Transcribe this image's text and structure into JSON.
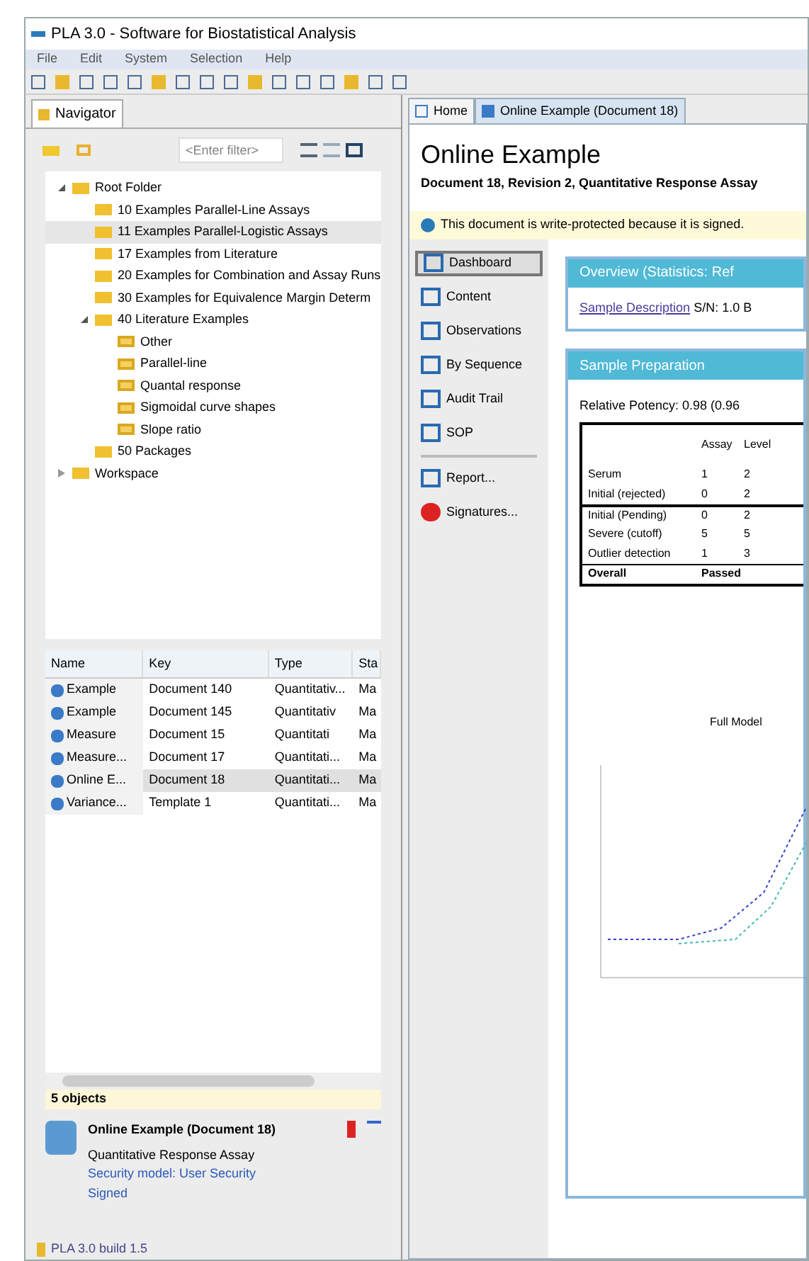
{
  "window": {
    "title": "PLA 3.0 - Software for Biostatistical Analysis"
  },
  "menu": [
    "File",
    "Edit",
    "System",
    "Selection",
    "Help"
  ],
  "navigator": {
    "tab": "Navigator",
    "filter": {
      "placeholder": "<Enter filter>"
    },
    "tree": [
      {
        "label": "Root Folder",
        "expanded": true,
        "selected": false,
        "children": [
          {
            "label": "10 Examples Parallel-Line Assays",
            "selected": false
          },
          {
            "label": "11 Examples Parallel-Logistic Assays",
            "selected": true
          },
          {
            "label": "17 Examples from Literature",
            "selected": false
          },
          {
            "label": "20 Examples for Combination and Assay Runs",
            "selected": false
          },
          {
            "label": "30 Examples for Equivalence Margin Determ",
            "selected": false
          },
          {
            "label": "40 Literature Examples",
            "expanded": true,
            "selected": false,
            "children": [
              {
                "label": "Other",
                "selected": false
              },
              {
                "label": "Parallel-line",
                "selected": false
              },
              {
                "label": "Quantal response",
                "selected": false
              },
              {
                "label": "Sigmoidal curve shapes",
                "selected": false
              },
              {
                "label": "Slope ratio",
                "selected": false
              }
            ]
          },
          {
            "label": "50 Packages",
            "selected": false
          }
        ]
      },
      {
        "label": "Workspace",
        "expanded": false,
        "selected": false
      }
    ]
  },
  "table": {
    "columns": [
      "Name",
      "Key",
      "Type",
      "Sta"
    ],
    "rows": [
      {
        "cells": [
          "Example",
          "Document 140",
          "Quantitativ...",
          "Ma"
        ],
        "selected": false
      },
      {
        "cells": [
          "Example",
          "Document 145",
          "Quantitativ",
          "Ma"
        ],
        "selected": false
      },
      {
        "cells": [
          "Measure",
          "Document 15",
          "Quantitati",
          "Ma"
        ],
        "selected": false
      },
      {
        "cells": [
          "Measure...",
          "Document 17",
          "Quantitati...",
          "Ma"
        ],
        "selected": false
      },
      {
        "cells": [
          "Online E...",
          "Document 18",
          "Quantitati...",
          "Ma"
        ],
        "selected": true
      },
      {
        "cells": [
          "Variance...",
          "Template 1",
          "Quantitati...",
          "Ma"
        ],
        "selected": false
      }
    ]
  },
  "objects_count": "5 objects",
  "detail": {
    "title": "Online Example (Document 18)",
    "lines": [
      "Quantitative Response Assay",
      "Security model: User Security",
      "Signed"
    ]
  },
  "status_bar": "PLA 3.0 build 1.5",
  "editor": {
    "tabs": [
      {
        "label": "Home",
        "selected": false
      },
      {
        "label": "Online Example (Document 18)",
        "selected": true
      }
    ],
    "title": "Online Example",
    "subtitle": "Document 18, Revision 2, Quantitative Response Assay",
    "info": "This document is write-protected because it is signed.",
    "nav": [
      {
        "label": "Dashboard",
        "selected": true
      },
      {
        "label": "Content",
        "selected": false
      },
      {
        "label": "Observations",
        "selected": false
      },
      {
        "label": "By Sequence",
        "selected": false
      },
      {
        "label": "Audit Trail",
        "selected": false
      },
      {
        "label": "SOP",
        "selected": false
      },
      {
        "label": "Report...",
        "selected": false
      },
      {
        "label": "Signatures...",
        "selected": false
      }
    ],
    "overview": {
      "header": "Overview (Statistics: Ref",
      "link": "Sample Description",
      "text": "S/N: 1.0 B"
    },
    "preparation": {
      "header": "Sample Preparation",
      "summary": "Relative Potency: 0.98 (0.96",
      "columns": [
        "",
        "Assay",
        "Level"
      ],
      "rows": [
        [
          "Serum",
          "1",
          "2"
        ],
        [
          "Initial (rejected)",
          "0",
          "2"
        ],
        [
          "Initial (Pending)",
          "0",
          "2"
        ],
        [
          "Severe (cutoff)",
          "5",
          "5"
        ],
        [
          "Outlier detection",
          "1",
          "3"
        ]
      ],
      "overall": [
        "Overall",
        "Passed"
      ],
      "chart_title": "Full Model"
    }
  }
}
